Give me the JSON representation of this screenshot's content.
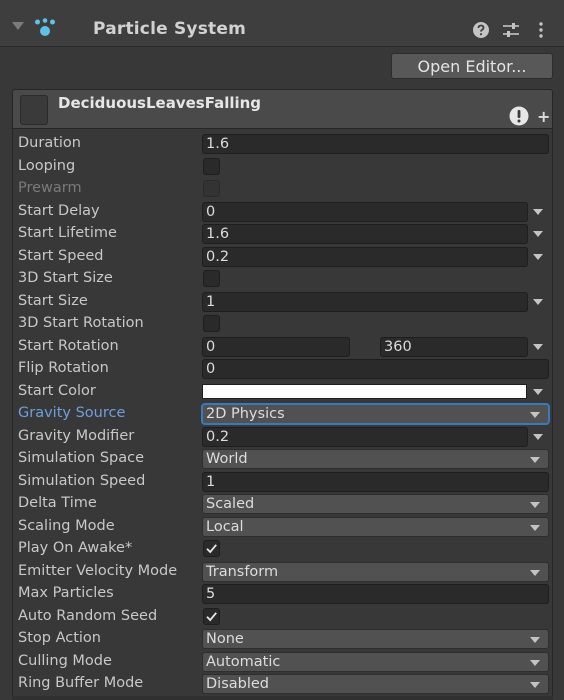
{
  "header": {
    "title": "Particle System",
    "icons": [
      "fold-arrow-icon",
      "particle-system-icon",
      "help-icon",
      "presets-icon",
      "more-menu-icon"
    ]
  },
  "toolbar": {
    "open_editor_label": "Open Editor..."
  },
  "module": {
    "name": "DeciduousLeavesFalling",
    "icons": [
      "object-thumbnail-icon",
      "warning-icon",
      "add-icon"
    ]
  },
  "properties": {
    "duration": {
      "label": "Duration",
      "value": "1.6"
    },
    "looping": {
      "label": "Looping",
      "checked": false
    },
    "prewarm": {
      "label": "Prewarm",
      "checked": false,
      "disabled": true
    },
    "start_delay": {
      "label": "Start Delay",
      "value": "0"
    },
    "start_lifetime": {
      "label": "Start Lifetime",
      "value": "1.6"
    },
    "start_speed": {
      "label": "Start Speed",
      "value": "0.2"
    },
    "start_size_3d": {
      "label": "3D Start Size",
      "checked": false
    },
    "start_size": {
      "label": "Start Size",
      "value": "1"
    },
    "start_rotation_3d": {
      "label": "3D Start Rotation",
      "checked": false
    },
    "start_rotation": {
      "label": "Start Rotation",
      "min": "0",
      "max": "360"
    },
    "flip_rotation": {
      "label": "Flip Rotation",
      "value": "0"
    },
    "start_color": {
      "label": "Start Color",
      "color": "#ffffff"
    },
    "gravity_source": {
      "label": "Gravity Source",
      "value": "2D Physics"
    },
    "gravity_modifier": {
      "label": "Gravity Modifier",
      "value": "0.2"
    },
    "simulation_space": {
      "label": "Simulation Space",
      "value": "World"
    },
    "simulation_speed": {
      "label": "Simulation Speed",
      "value": "1"
    },
    "delta_time": {
      "label": "Delta Time",
      "value": "Scaled"
    },
    "scaling_mode": {
      "label": "Scaling Mode",
      "value": "Local"
    },
    "play_on_awake": {
      "label": "Play On Awake*",
      "checked": true
    },
    "emitter_velocity_mode": {
      "label": "Emitter Velocity Mode",
      "value": "Transform"
    },
    "max_particles": {
      "label": "Max Particles",
      "value": "5"
    },
    "auto_random_seed": {
      "label": "Auto Random Seed",
      "checked": true
    },
    "stop_action": {
      "label": "Stop Action",
      "value": "None"
    },
    "culling_mode": {
      "label": "Culling Mode",
      "value": "Automatic"
    },
    "ring_buffer_mode": {
      "label": "Ring Buffer Mode",
      "value": "Disabled"
    }
  },
  "colors": {
    "background": "#383838",
    "field": "#2a2a2a",
    "dropdown": "#515151",
    "focus": "#3a79bb",
    "focused_label": "#6e9fde",
    "icon_accent": "#5ec2e8"
  }
}
